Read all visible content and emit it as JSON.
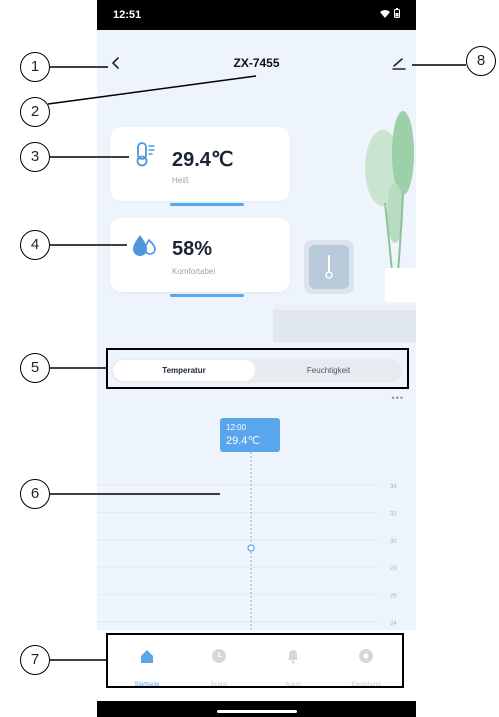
{
  "status_bar": {
    "time": "12:51",
    "icons": [
      "wifi-icon",
      "battery-icon"
    ]
  },
  "header": {
    "title": "ZX-7455",
    "back_icon": "chevron-left-icon",
    "edit_icon": "pencil-icon"
  },
  "temperature_card": {
    "value": "29.4℃",
    "status": "Heiß",
    "icon": "thermometer-icon"
  },
  "humidity_card": {
    "value": "58%",
    "status": "Komfortabel",
    "icon": "humidity-drop-icon"
  },
  "segmented_control": {
    "options": [
      "Temperatur",
      "Feuchtigkeit"
    ],
    "selected": "Temperatur"
  },
  "chart": {
    "tooltip_time": "12:00",
    "tooltip_value": "29.4℃",
    "y_ticks": [
      "34",
      "32",
      "30",
      "28",
      "26",
      "24"
    ],
    "more_icon": "more-dots-icon"
  },
  "chart_data": {
    "type": "line",
    "x": [
      "12:00"
    ],
    "series": [
      {
        "values": [
          29.4
        ]
      }
    ],
    "ylim": [
      24,
      34
    ],
    "yticks": [
      34,
      32,
      30,
      28,
      26,
      24
    ],
    "grid": true
  },
  "tab_bar": {
    "tabs": [
      {
        "label": "Startseite",
        "icon": "home-icon",
        "active": true
      },
      {
        "label": "Schlaf",
        "icon": "clock-icon",
        "active": false
      },
      {
        "label": "Alarm",
        "icon": "bell-icon",
        "active": false
      },
      {
        "label": "Einstellung",
        "icon": "gear-icon",
        "active": false
      }
    ]
  },
  "annotations": [
    "1",
    "2",
    "3",
    "4",
    "5",
    "6",
    "7",
    "8"
  ],
  "colors": {
    "accent": "#5aa6ec",
    "background": "#eef4fb",
    "card": "#ffffff",
    "text_dark": "#1b2436"
  }
}
